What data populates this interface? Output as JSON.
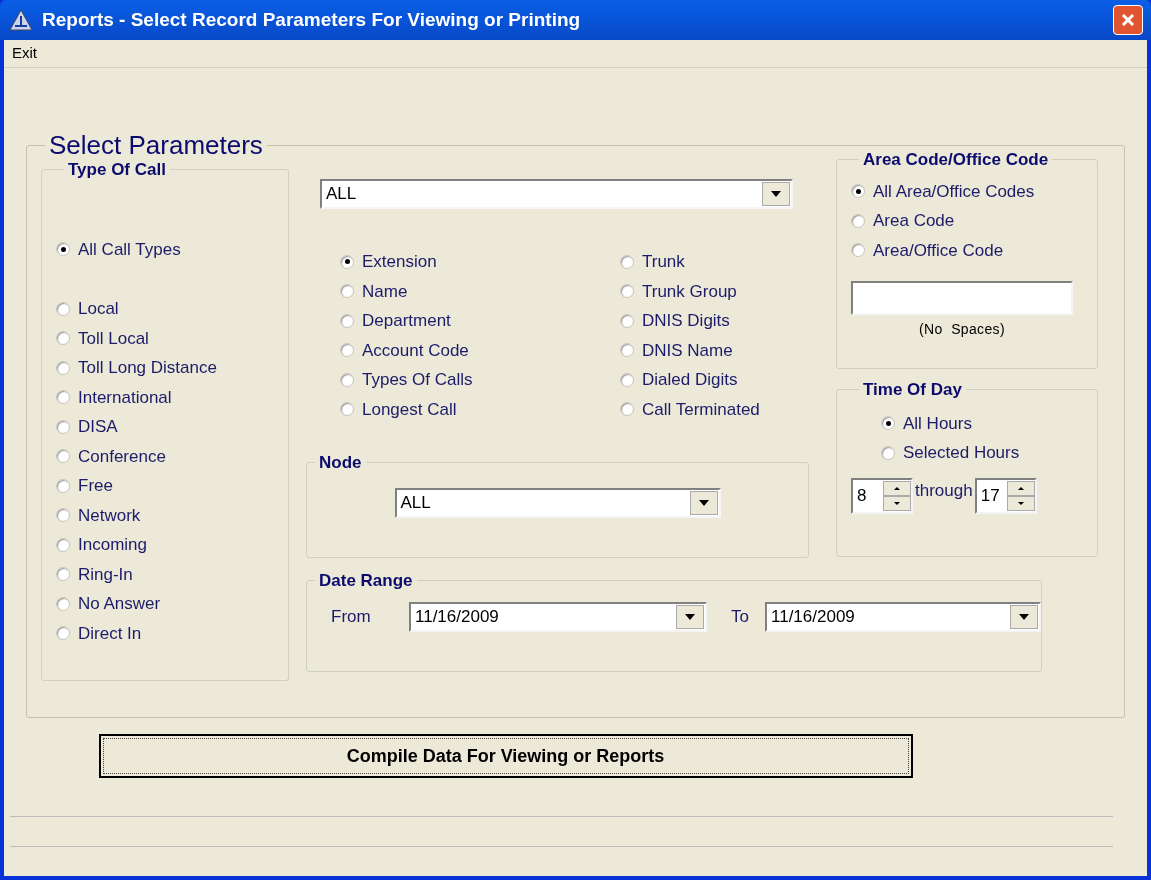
{
  "window": {
    "title": "Reports - Select Record Parameters For Viewing or Printing"
  },
  "menu": [
    "Exit"
  ],
  "parameters": {
    "title": "Select Parameters",
    "type_of_call": {
      "title": "Type Of Call",
      "options": [
        {
          "label": "All Call Types",
          "selected": true
        },
        {
          "label": "Local",
          "selected": false
        },
        {
          "label": "Toll Local",
          "selected": false
        },
        {
          "label": "Toll Long Distance",
          "selected": false
        },
        {
          "label": "International",
          "selected": false
        },
        {
          "label": "DISA",
          "selected": false
        },
        {
          "label": "Conference",
          "selected": false
        },
        {
          "label": "Free",
          "selected": false
        },
        {
          "label": "Network",
          "selected": false
        },
        {
          "label": "Incoming",
          "selected": false
        },
        {
          "label": "Ring-In",
          "selected": false
        },
        {
          "label": "No Answer",
          "selected": false
        },
        {
          "label": "Direct In",
          "selected": false
        }
      ]
    },
    "filter": {
      "value": "ALL"
    },
    "record_options": [
      {
        "label": "Extension",
        "selected": true
      },
      {
        "label": "Name",
        "selected": false
      },
      {
        "label": "Department",
        "selected": false
      },
      {
        "label": "Account Code",
        "selected": false
      },
      {
        "label": "Types Of Calls",
        "selected": false
      },
      {
        "label": "Longest Call",
        "selected": false
      },
      {
        "label": "Trunk",
        "selected": false
      },
      {
        "label": "Trunk Group",
        "selected": false
      },
      {
        "label": "DNIS Digits",
        "selected": false
      },
      {
        "label": "DNIS Name",
        "selected": false
      },
      {
        "label": "Dialed Digits",
        "selected": false
      },
      {
        "label": "Call Terminated",
        "selected": false
      }
    ],
    "node": {
      "title": "Node",
      "value": "ALL"
    },
    "date_range": {
      "title": "Date Range",
      "from_label": "From",
      "from": "11/16/2009",
      "to_label": "To",
      "to": "11/16/2009"
    },
    "area_code": {
      "title": "Area Code/Office Code",
      "options": [
        {
          "label": "All Area/Office Codes",
          "selected": true
        },
        {
          "label": "Area Code",
          "selected": false
        },
        {
          "label": "Area/Office Code",
          "selected": false
        }
      ],
      "note": "(No  Spaces)"
    },
    "time_of_day": {
      "title": "Time Of Day",
      "options": [
        {
          "label": "All Hours",
          "selected": true
        },
        {
          "label": "Selected Hours",
          "selected": false
        }
      ],
      "start": "8",
      "through": "through",
      "end": "17"
    }
  },
  "compile_button": "Compile Data For Viewing or Reports"
}
